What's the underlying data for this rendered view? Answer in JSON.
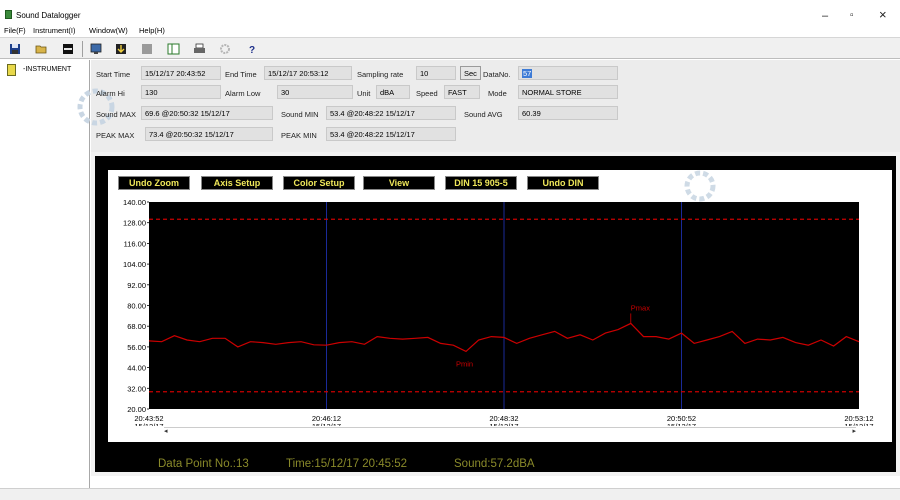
{
  "window": {
    "title": "Sound Datalogger",
    "minimize": "–",
    "maximize": "▫",
    "close": "×"
  },
  "menu": [
    "File(F)",
    "Instrument(I)",
    "Window(W)",
    "Help(H)"
  ],
  "toolbar": [
    "save-icon",
    "open-icon",
    "black-bar-icon",
    "monitor-icon",
    "download-icon",
    "gray-square-icon",
    "panel-icon",
    "printer-icon",
    "gear-icon",
    "help-icon"
  ],
  "tree": {
    "node": "-INSTRUMENT"
  },
  "info": {
    "start_time_label": "Start Time",
    "start_time": "15/12/17 20:43:52",
    "end_time_label": "End Time",
    "end_time": "15/12/17 20:53:12",
    "sampling_rate_label": "Sampling rate",
    "sampling_rate": "10",
    "sampling_unit": "Sec",
    "datano_label": "DataNo.",
    "datano": "57",
    "alarm_hi_label": "Alarm Hi",
    "alarm_hi": "130",
    "alarm_low_label": "Alarm Low",
    "alarm_low": "30",
    "unit_label": "Unit",
    "unit": "dBA",
    "speed_label": "Speed",
    "speed": "FAST",
    "mode_label": "Mode",
    "mode": "NORMAL STORE",
    "sound_max_label": "Sound MAX",
    "sound_max": "69.6 @20:50:32 15/12/17",
    "sound_min_label": "Sound MIN",
    "sound_min": "53.4 @20:48:22 15/12/17",
    "sound_avg_label": "Sound AVG",
    "sound_avg": "60.39",
    "peak_max_label": "PEAK MAX",
    "peak_max": "73.4 @20:50:32 15/12/17",
    "peak_min_label": "PEAK MIN",
    "peak_min": "53.4 @20:48:22 15/12/17"
  },
  "chart_buttons": [
    "Undo Zoom",
    "Axis Setup",
    "Color Setup",
    "View",
    "DIN 15 905-5",
    "Undo DIN"
  ],
  "status": {
    "data_point": "Data Point No.:13",
    "time": "Time:15/12/17 20:45:52",
    "sound": "Sound:57.2dBA"
  },
  "colors": {
    "plot_bg": "#000000",
    "line": "#cc0000",
    "grid": "#1a2a99",
    "limit": "#cc0000",
    "status_text": "#8a8a2a",
    "button_text": "#f0e85a"
  },
  "chart_data": {
    "type": "line",
    "title": "",
    "xlabel": "",
    "ylabel": "",
    "ylim": [
      20,
      140
    ],
    "yticks": [
      "140.00",
      "128.00",
      "116.00",
      "104.00",
      "92.00",
      "80.00",
      "68.00",
      "56.00",
      "44.00",
      "32.00",
      "20.00"
    ],
    "xticks": [
      {
        "time": "20:43:52",
        "date": "15/12/17"
      },
      {
        "time": "20:46:12",
        "date": "15/12/17"
      },
      {
        "time": "20:48:32",
        "date": "15/12/17"
      },
      {
        "time": "20:50:52",
        "date": "15/12/17"
      },
      {
        "time": "20:53:12",
        "date": "15/12/17"
      }
    ],
    "limits": {
      "alarm_hi": 130,
      "alarm_low": 30
    },
    "series": [
      {
        "values": [
          59.5,
          59.0,
          62.5,
          60.0,
          59.0,
          61.0,
          61.0,
          56.0,
          59.0,
          58.5,
          57.5,
          58.5,
          59.0,
          57.2,
          57.0,
          58.5,
          59.0,
          57.5,
          62.0,
          61.0,
          60.5,
          61.0,
          61.5,
          58.0,
          57.0,
          53.4,
          60.0,
          62.0,
          61.5,
          58.0,
          61.0,
          63.0,
          65.0,
          61.0,
          63.0,
          60.0,
          64.0,
          66.0,
          69.6,
          62.0,
          62.0,
          60.5,
          64.0,
          58.0,
          60.0,
          62.0,
          65.0,
          58.0,
          60.5,
          60.0,
          61.5,
          58.5,
          57.0,
          60.0,
          56.5,
          62.0,
          59.0
        ]
      }
    ],
    "annotations": [
      {
        "label": "Pmax",
        "index": 38
      },
      {
        "label": "Pmin",
        "index": 25
      }
    ]
  }
}
